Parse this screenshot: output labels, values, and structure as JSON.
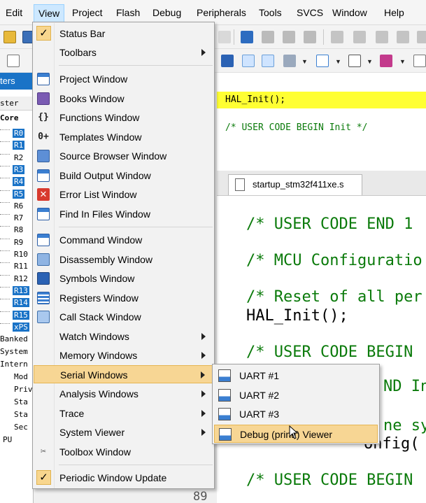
{
  "menubar": {
    "items": [
      "Edit",
      "View",
      "Project",
      "Flash",
      "Debug",
      "Peripherals",
      "Tools",
      "SVCS",
      "Window",
      "Help"
    ]
  },
  "registers_panel": {
    "title": "ters",
    "header": "ster",
    "core_label": "Core",
    "registers": [
      {
        "name": "R0",
        "selected": true
      },
      {
        "name": "R1",
        "selected": true
      },
      {
        "name": "R2",
        "selected": false
      },
      {
        "name": "R3",
        "selected": true
      },
      {
        "name": "R4",
        "selected": true
      },
      {
        "name": "R5",
        "selected": true
      },
      {
        "name": "R6",
        "selected": false
      },
      {
        "name": "R7",
        "selected": false
      },
      {
        "name": "R8",
        "selected": false
      },
      {
        "name": "R9",
        "selected": false
      },
      {
        "name": "R10",
        "selected": false
      },
      {
        "name": "R11",
        "selected": false
      },
      {
        "name": "R12",
        "selected": false
      },
      {
        "name": "R13",
        "selected": true
      },
      {
        "name": "R14",
        "selected": true
      },
      {
        "name": "R15",
        "selected": true
      },
      {
        "name": "xPS",
        "selected": true
      }
    ],
    "below": [
      "Banked",
      "System",
      "Intern",
      "Mod",
      "Priv",
      "Sta",
      "Sta",
      "Sec",
      "PU"
    ]
  },
  "editor_top": {
    "line1": "HAL_Init();",
    "line2": "/* USER CODE BEGIN Init */"
  },
  "tab": {
    "label": "startup_stm32f411xe.s"
  },
  "editor_main": {
    "lines": [
      "/* USER CODE END 1",
      "/* MCU Configuratio",
      "/* Reset of all per",
      "HAL_Init();",
      "/* USER CODE BEGIN",
      "/* USER CODE BEGIN"
    ],
    "behind_fragments": [
      "ND In",
      "ne sy",
      "onfig("
    ],
    "line_number": "89"
  },
  "view_menu": {
    "items": [
      {
        "label": "Status Bar",
        "checked": true
      },
      {
        "label": "Toolbars",
        "submenu": true
      },
      {
        "label": "Project Window"
      },
      {
        "label": "Books Window"
      },
      {
        "label": "Functions Window"
      },
      {
        "label": "Templates Window"
      },
      {
        "label": "Source Browser Window"
      },
      {
        "label": "Build Output Window"
      },
      {
        "label": "Error List Window"
      },
      {
        "label": "Find In Files Window"
      },
      {
        "label": "Command Window"
      },
      {
        "label": "Disassembly Window"
      },
      {
        "label": "Symbols Window"
      },
      {
        "label": "Registers Window"
      },
      {
        "label": "Call Stack Window"
      },
      {
        "label": "Watch Windows",
        "submenu": true
      },
      {
        "label": "Memory Windows",
        "submenu": true
      },
      {
        "label": "Serial Windows",
        "submenu": true,
        "highlighted": true
      },
      {
        "label": "Analysis Windows",
        "submenu": true
      },
      {
        "label": "Trace",
        "submenu": true
      },
      {
        "label": "System Viewer",
        "submenu": true
      },
      {
        "label": "Toolbox Window"
      },
      {
        "label": "Periodic Window Update",
        "checked": true
      }
    ],
    "check_glyph": "✓"
  },
  "serial_submenu": {
    "items": [
      {
        "label": "UART #1"
      },
      {
        "label": "UART #2"
      },
      {
        "label": "UART #3"
      },
      {
        "label": "Debug (printf) Viewer",
        "highlighted": true
      }
    ]
  },
  "colors": {
    "menu_highlight": "#f7d694",
    "selection_blue": "#1a73c7",
    "code_highlight_yellow": "#ffff33",
    "comment_green": "#0a7a0a"
  }
}
